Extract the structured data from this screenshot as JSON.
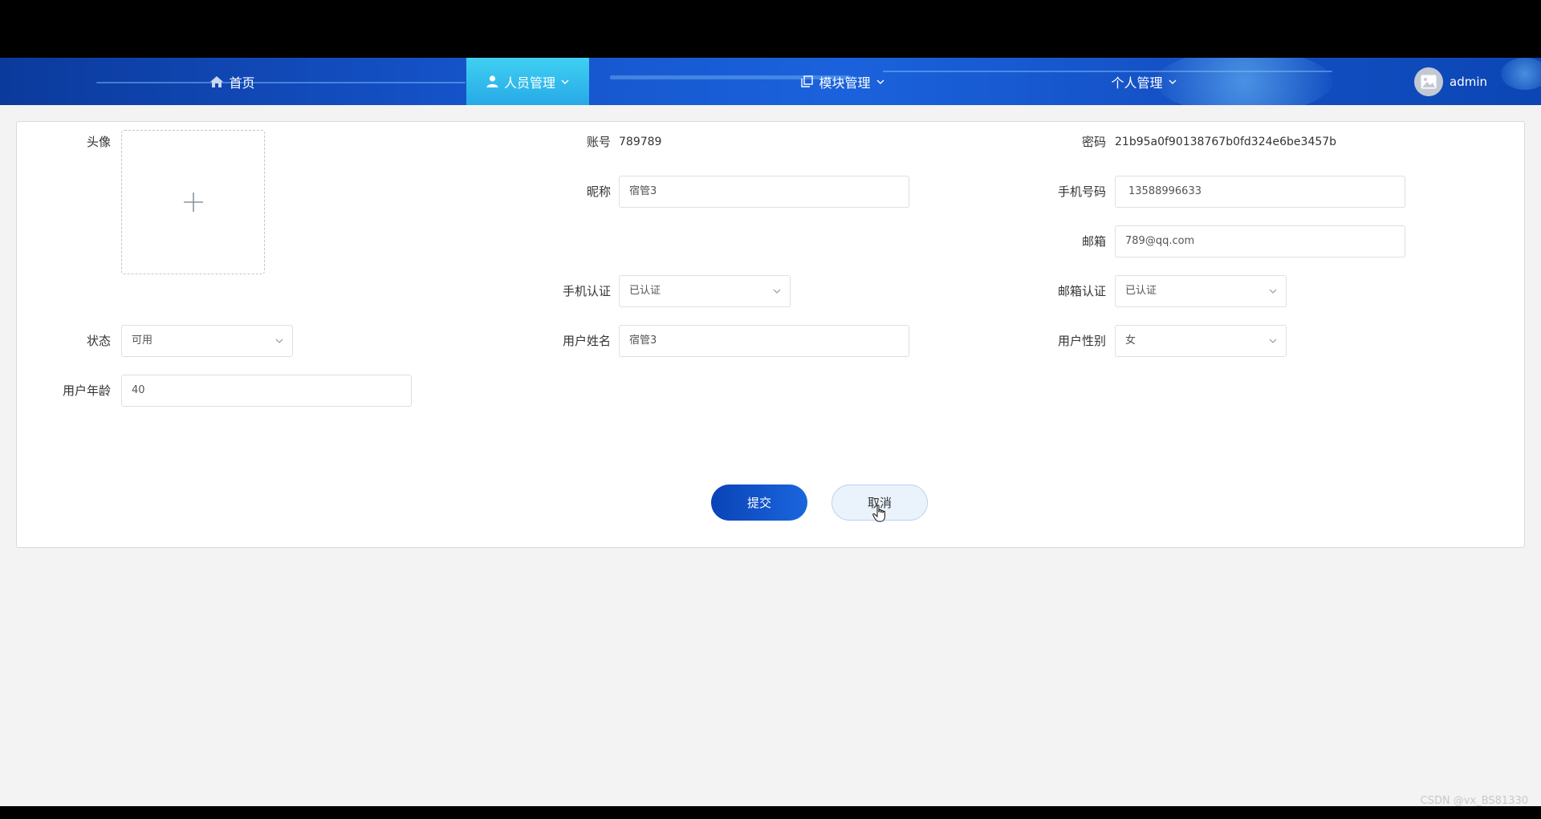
{
  "nav": {
    "home": "首页",
    "personnel": "人员管理",
    "modules": "模块管理",
    "personal": "个人管理",
    "username": "admin"
  },
  "form": {
    "avatar_label": "头像",
    "account_label": "账号",
    "account_value": "789789",
    "password_label": "密码",
    "password_value": "21b95a0f90138767b0fd324e6be3457b",
    "nickname_label": "昵称",
    "nickname_value": "宿管3",
    "phone_label": "手机号码",
    "phone_value": "13588996633",
    "email_label": "邮箱",
    "email_value": "789@qq.com",
    "phone_auth_label": "手机认证",
    "phone_auth_value": "已认证",
    "email_auth_label": "邮箱认证",
    "email_auth_value": "已认证",
    "status_label": "状态",
    "status_value": "可用",
    "realname_label": "用户姓名",
    "realname_value": "宿管3",
    "gender_label": "用户性别",
    "gender_value": "女",
    "age_label": "用户年龄",
    "age_value": "40",
    "submit": "提交",
    "cancel": "取消"
  },
  "watermark": "CSDN @vx_BS81330",
  "colors": {
    "nav_blue": "#1553c9",
    "nav_active": "#3fd0f2",
    "primary_button": "#0a43b7"
  }
}
